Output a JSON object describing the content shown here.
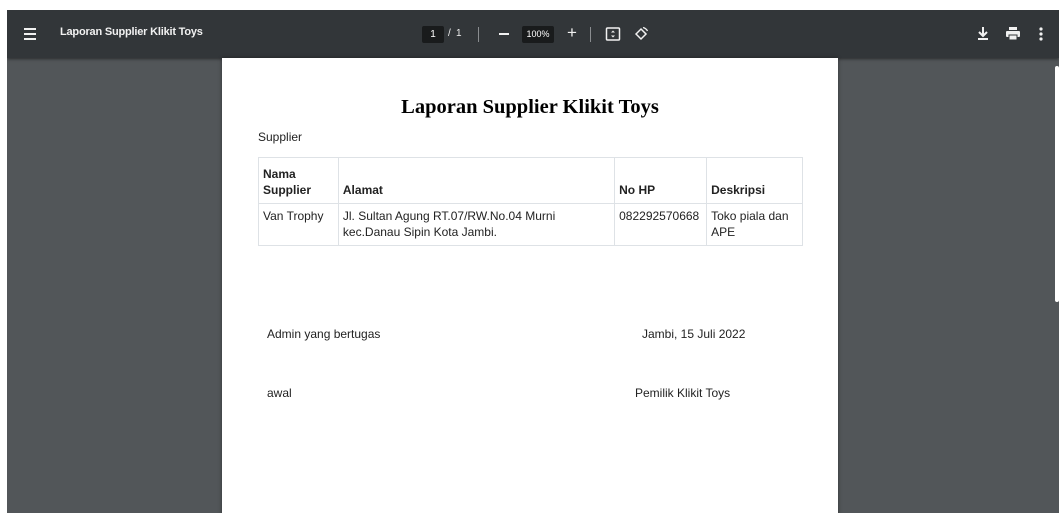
{
  "toolbar": {
    "title": "Laporan Supplier Klikit Toys",
    "current_page": "1",
    "page_separator": "/",
    "total_pages": "1",
    "zoom": "100%",
    "zoom_in_label": "+"
  },
  "document": {
    "title": "Laporan Supplier Klikit Toys",
    "section_label": "Supplier",
    "table": {
      "headers": [
        "Nama Supplier",
        "Alamat",
        "No HP",
        "Deskripsi"
      ],
      "rows": [
        [
          "Van Trophy",
          "Jl. Sultan Agung RT.07/RW.No.04 Murni kec.Danau Sipin Kota Jambi.",
          "082292570668",
          "Toko piala dan APE"
        ]
      ]
    },
    "signature": {
      "left_role": "Admin yang bertugas",
      "left_name": "awal",
      "right_place_date": "Jambi, 15 Juli 2022",
      "right_name": "Pemilik Klikit Toys"
    }
  },
  "icons": {
    "menu": "menu-icon",
    "fit": "fit-to-page-icon",
    "rotate": "rotate-icon",
    "download": "download-icon",
    "print": "print-icon",
    "more": "more-vert-icon"
  },
  "colors": {
    "toolbar_bg": "#323639",
    "viewer_bg": "#525659",
    "page_bg": "#ffffff",
    "table_border": "#dee2e6"
  }
}
